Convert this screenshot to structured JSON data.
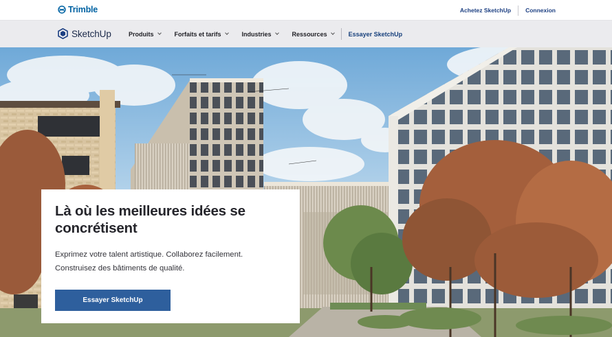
{
  "utility_bar": {
    "brand": "Trimble",
    "links": [
      {
        "label": "Achetez SketchUp"
      },
      {
        "label": "Connexion"
      }
    ]
  },
  "main_nav": {
    "logo_text": "SketchUp",
    "items": [
      {
        "label": "Produits"
      },
      {
        "label": "Forfaits et tarifs"
      },
      {
        "label": "Industries"
      },
      {
        "label": "Ressources"
      }
    ],
    "cta": "Essayer SketchUp"
  },
  "hero": {
    "title": "Là où les meilleures idées se concrétisent",
    "description": "Exprimez votre talent artistique. Collaborez facilement. Construisez des bâtiments de qualité.",
    "button_label": "Essayer SketchUp"
  },
  "colors": {
    "brand_blue": "#0063a3",
    "nav_text": "#1c3f82",
    "cta_button": "#2e5f9d",
    "nav_background": "#ebebee"
  }
}
